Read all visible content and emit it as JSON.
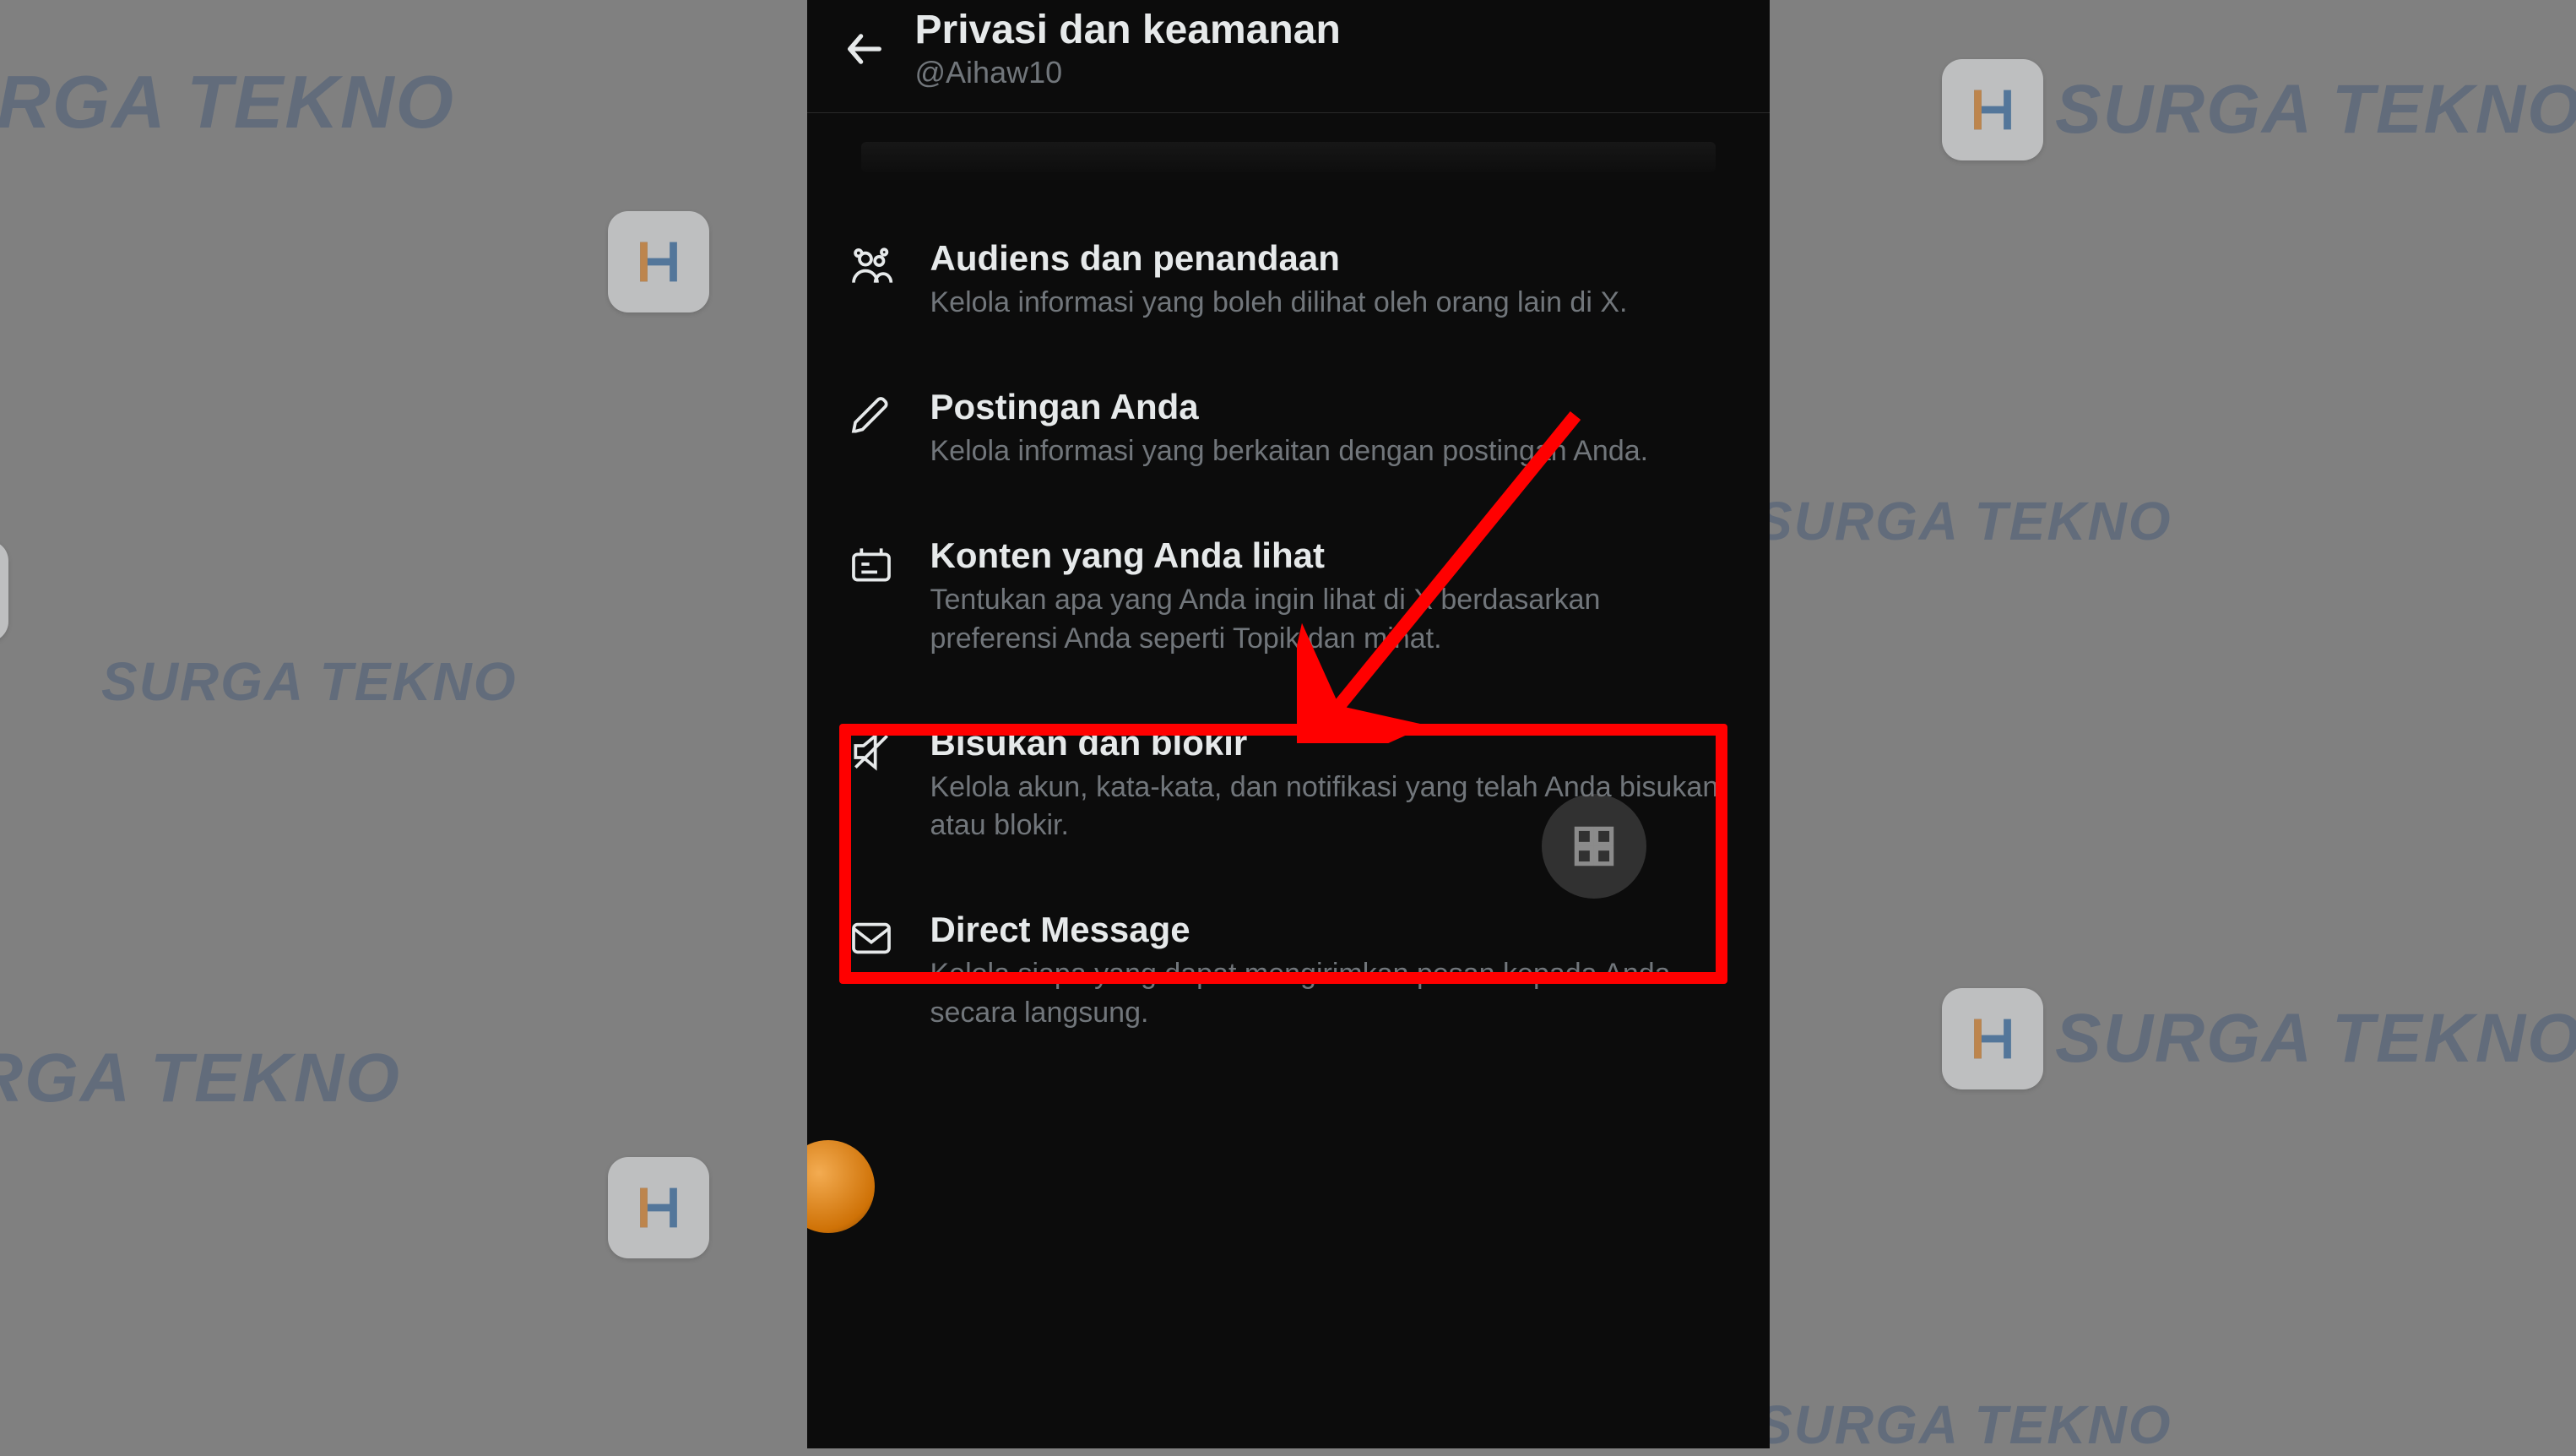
{
  "watermark": {
    "text": "SURGA TEKNO"
  },
  "header": {
    "title": "Privasi dan keamanan",
    "handle": "@Aihaw10"
  },
  "items": [
    {
      "title": "Audiens dan penandaan",
      "desc": "Kelola informasi yang boleh dilihat oleh orang lain di X.",
      "icon": "audience"
    },
    {
      "title": "Postingan Anda",
      "desc": "Kelola informasi yang berkaitan dengan postingan Anda.",
      "icon": "pencil"
    },
    {
      "title": "Konten yang Anda lihat",
      "desc": "Tentukan apa yang Anda ingin lihat di X berdasarkan preferensi Anda seperti Topik dan minat.",
      "icon": "content"
    },
    {
      "title": "Bisukan dan blokir",
      "desc": "Kelola akun, kata-kata, dan notifikasi yang telah Anda bisukan atau blokir.",
      "icon": "mute"
    },
    {
      "title": "Direct Message",
      "desc": "Kelola siapa yang dapat mengirimkan pesan kepada Anda secara langsung.",
      "icon": "mail"
    }
  ]
}
